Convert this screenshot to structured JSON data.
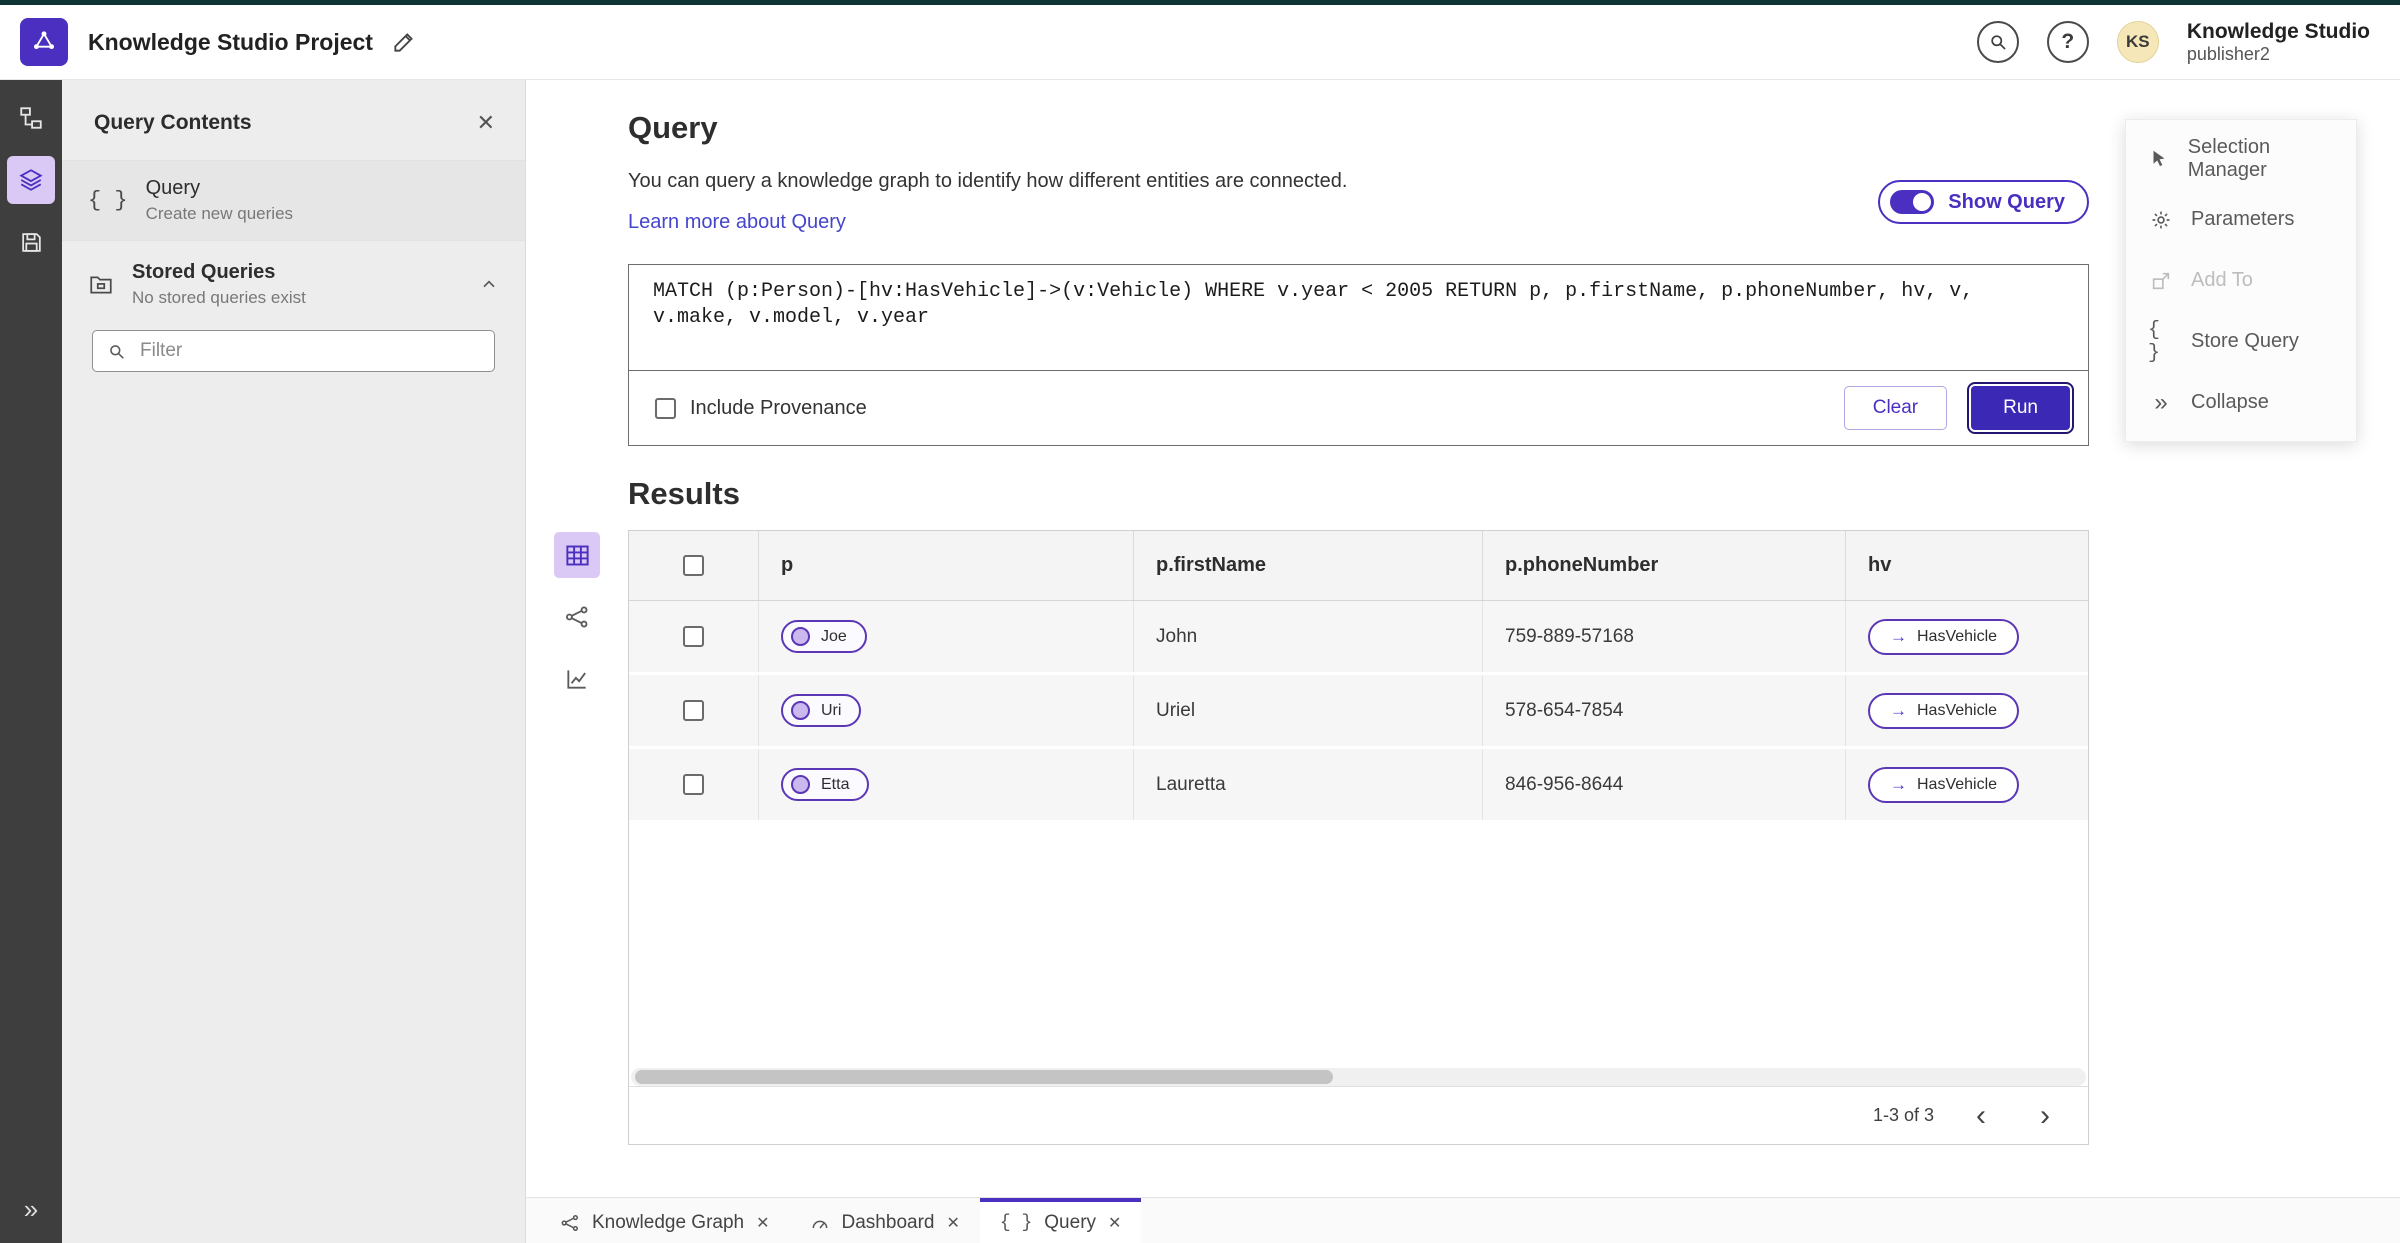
{
  "colors": {
    "primary": "#4b2fc0",
    "primary_dark": "#241670",
    "chip_fill": "#cbb8ee",
    "rail_selected_bg": "#d9c9f4",
    "link": "#4545cb",
    "top_strip": "#0e3434",
    "avatar_bg": "#f5e7b8"
  },
  "header": {
    "app_title": "Knowledge Studio Project",
    "product_name": "Knowledge Studio",
    "user_name": "publisher2",
    "avatar_initials": "KS",
    "help_glyph": "?"
  },
  "left_panel": {
    "title": "Query Contents",
    "close_glyph": "✕",
    "query_item": {
      "label": "Query",
      "description": "Create new queries"
    },
    "stored_queries": {
      "label": "Stored Queries",
      "description": "No stored queries exist"
    },
    "filter_placeholder": "Filter"
  },
  "query_section": {
    "title": "Query",
    "description": "You can query a knowledge graph to identify how different entities are connected.",
    "learn_more_link": "Learn more about Query",
    "show_query_label": "Show Query",
    "show_query_on": true,
    "query_text": "MATCH (p:Person)-[hv:HasVehicle]->(v:Vehicle) WHERE v.year < 2005 RETURN p, p.firstName, p.phoneNumber, hv, v, v.make, v.model, v.year",
    "include_provenance_label": "Include Provenance",
    "clear_button": "Clear",
    "run_button": "Run"
  },
  "results_section": {
    "title": "Results",
    "columns": [
      "p",
      "p.firstName",
      "p.phoneNumber",
      "hv"
    ],
    "rows": [
      {
        "p": "Joe",
        "firstName": "John",
        "phoneNumber": "759-889-57168",
        "hv": "HasVehicle"
      },
      {
        "p": "Uri",
        "firstName": "Uriel",
        "phoneNumber": "578-654-7854",
        "hv": "HasVehicle"
      },
      {
        "p": "Etta",
        "firstName": "Lauretta",
        "phoneNumber": "846-956-8644",
        "hv": "HasVehicle"
      }
    ],
    "edge_arrow": "→",
    "pagination": "1-3 of 3",
    "prev_glyph": "‹",
    "next_glyph": "›"
  },
  "tools_menu": {
    "items": [
      {
        "label": "Selection Manager"
      },
      {
        "label": "Parameters"
      },
      {
        "label": "Add To"
      },
      {
        "label": "Store Query"
      },
      {
        "label": "Collapse"
      }
    ],
    "braces_glyph": "{ }",
    "collapse_glyph": "»"
  },
  "rail": {
    "expand_glyph": "»"
  },
  "bottom_tabs": [
    {
      "label": "Knowledge Graph"
    },
    {
      "label": "Dashboard"
    },
    {
      "label": "Query"
    }
  ],
  "tab_close_glyph": "✕",
  "panel_item_braces": "{ }"
}
